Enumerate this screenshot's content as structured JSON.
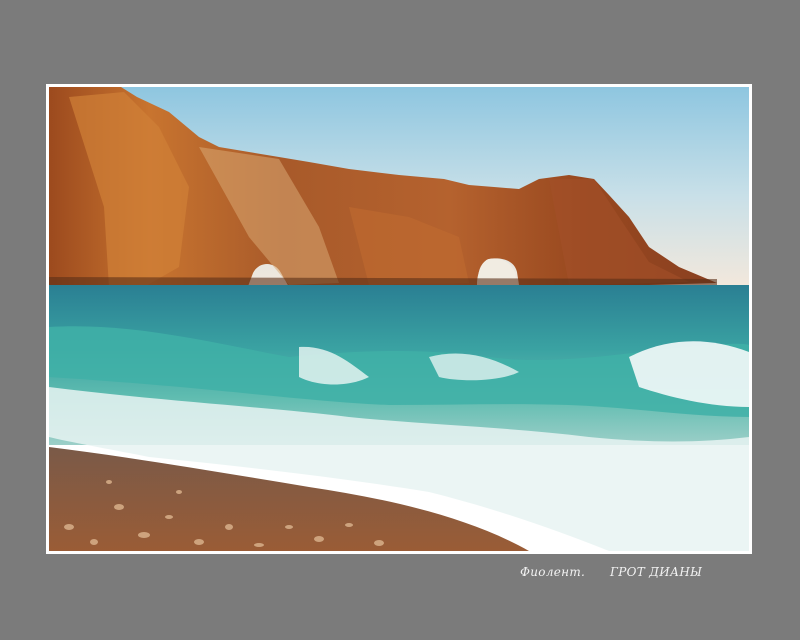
{
  "photo": {
    "subject": "sea-arch-photo",
    "colors": {
      "background": "#7b7b7b",
      "frame": "#ffffff",
      "sky_top": "#8ec6e0",
      "sky_bottom": "#f3ece2",
      "cliff": "#b8602a",
      "sea": "#2f8e93",
      "foam": "#e8f3f2",
      "pebbles": "#8a5a3c"
    }
  },
  "captions": {
    "location": "Фиолент.",
    "title": "ГРОТ ДИАНЫ"
  }
}
